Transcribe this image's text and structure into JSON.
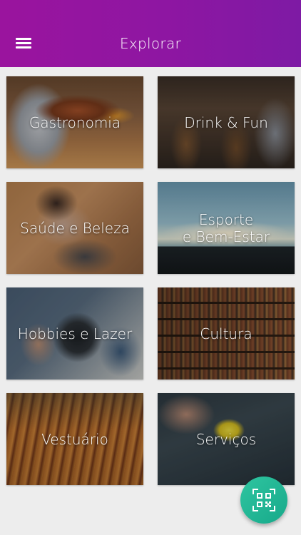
{
  "header": {
    "title": "Explorar",
    "menu_icon": "hamburger-menu-icon",
    "background": "#9a149e"
  },
  "categories": [
    {
      "label": "Gastronomia",
      "image": "plated-food-photo"
    },
    {
      "label": "Drink & Fun",
      "image": "bar-interior-photo"
    },
    {
      "label": "Saúde e Beleza",
      "image": "makeup-photo"
    },
    {
      "label": "Esporte\ne Bem-Estar",
      "image": "silhouettes-sunset-photo"
    },
    {
      "label": "Hobbies e Lazer",
      "image": "camera-photo"
    },
    {
      "label": "Cultura",
      "image": "bookshelf-photo"
    },
    {
      "label": "Vestuário",
      "image": "clothes-rack-photo"
    },
    {
      "label": "Serviços",
      "image": "cleaning-photo"
    }
  ],
  "fab": {
    "icon": "qr-code-icon",
    "color": "#2fc5a0"
  }
}
